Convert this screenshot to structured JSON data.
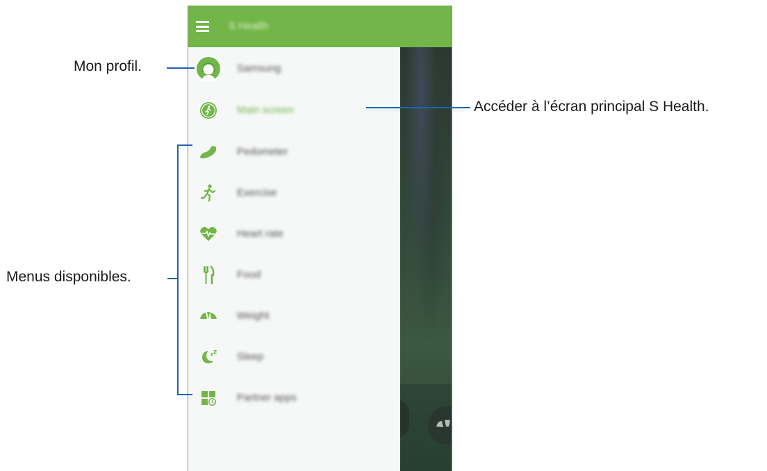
{
  "app": {
    "title": "S Health"
  },
  "drawer": {
    "profile_name": "Samsung",
    "items": [
      {
        "label": "Main screen",
        "icon": "main-screen-icon",
        "active": true
      },
      {
        "label": "Pedometer",
        "icon": "shoe-icon",
        "active": false
      },
      {
        "label": "Exercise",
        "icon": "runner-icon",
        "active": false
      },
      {
        "label": "Heart rate",
        "icon": "heart-rate-icon",
        "active": false
      },
      {
        "label": "Food",
        "icon": "fork-knife-icon",
        "active": false
      },
      {
        "label": "Weight",
        "icon": "scale-icon",
        "active": false
      },
      {
        "label": "Sleep",
        "icon": "moon-zz-icon",
        "active": false
      },
      {
        "label": "Partner apps",
        "icon": "partner-apps-icon",
        "active": false
      }
    ]
  },
  "annotations": {
    "profile": "Mon profil.",
    "main_screen": "Accéder à l’écran principal S Health.",
    "menus": "Menus disponibles."
  },
  "colors": {
    "accent": "#72b548",
    "leader_line": "#1f63b0"
  }
}
